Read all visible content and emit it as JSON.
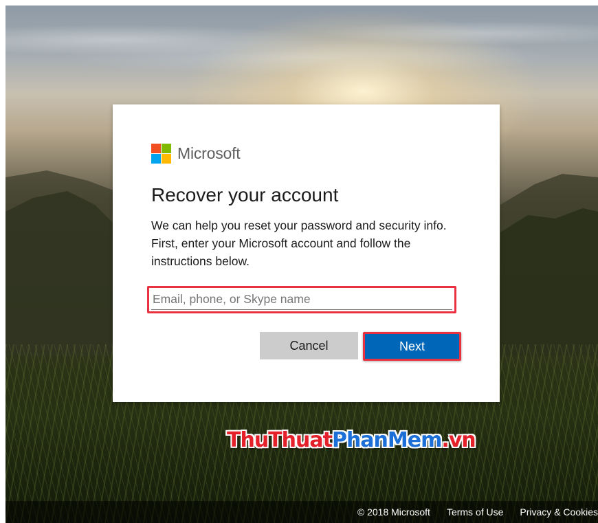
{
  "brand": {
    "name": "Microsoft",
    "logo_colors": [
      "#f25022",
      "#7fba00",
      "#00a4ef",
      "#ffb900"
    ]
  },
  "recover": {
    "title": "Recover your account",
    "description": "We can help you reset your password and security info. First, enter your Microsoft account and follow the instructions below.",
    "input": {
      "placeholder": "Email, phone, or Skype name",
      "value": ""
    },
    "cancel_label": "Cancel",
    "next_label": "Next"
  },
  "watermark": {
    "part1": "ThuThuat",
    "part2": "PhanMem",
    "part3": ".vn"
  },
  "footer": {
    "copyright": "© 2018 Microsoft",
    "terms": "Terms of Use",
    "privacy": "Privacy & Cookies"
  },
  "colors": {
    "accent": "#0067b8",
    "highlight": "#e8323f",
    "watermark_red": "#e4202a",
    "watermark_blue": "#1b6fd6"
  }
}
